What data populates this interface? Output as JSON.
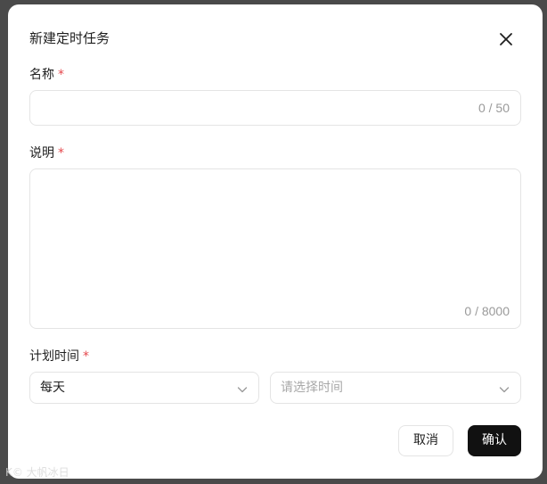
{
  "dialog": {
    "title": "新建定时任务"
  },
  "fields": {
    "name": {
      "label": "名称",
      "required_mark": "*",
      "value": "",
      "counter": "0 / 50"
    },
    "description": {
      "label": "说明",
      "required_mark": "*",
      "value": "",
      "counter": "0 / 8000"
    },
    "schedule": {
      "label": "计划时间",
      "required_mark": "*",
      "frequency_value": "每天",
      "time_placeholder": "请选择时间"
    }
  },
  "buttons": {
    "cancel_label": "取消",
    "confirm_label": "确认"
  },
  "colors": {
    "required": "#e5484d",
    "primary_button": "#111111",
    "overlay": "#4a4a4a"
  },
  "watermark": "K© 大帆冰日"
}
